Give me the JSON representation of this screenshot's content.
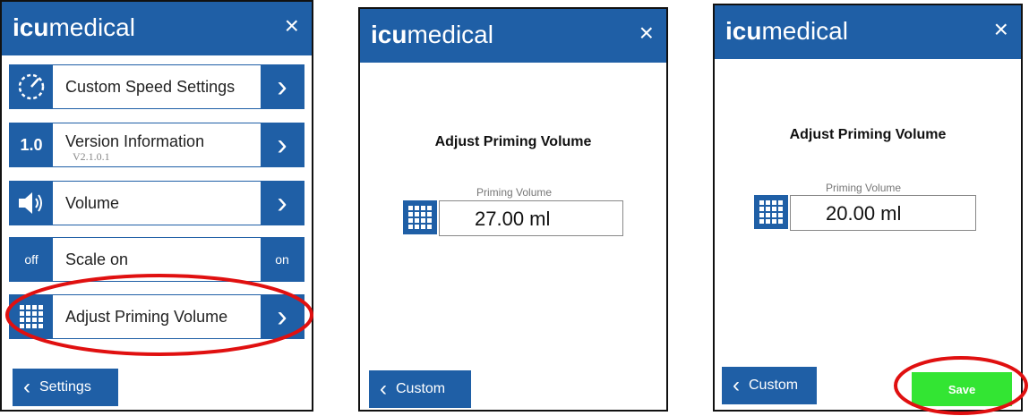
{
  "logo": {
    "bold": "icu",
    "light": "medical"
  },
  "close_glyph": "×",
  "screen1": {
    "rows": [
      {
        "icon": "speedometer-icon",
        "label": "Custom Speed Settings"
      },
      {
        "badge": "1.0",
        "label": "Version Information",
        "sub": "V2.1.0.1"
      },
      {
        "icon": "speaker-icon",
        "label": "Volume"
      },
      {
        "left": "off",
        "label": "Scale on",
        "right": "on"
      },
      {
        "icon": "keypad-icon",
        "label": "Adjust Priming Volume"
      }
    ],
    "back_label": "Settings"
  },
  "screen2": {
    "title": "Adjust Priming Volume",
    "field_label": "Priming Volume",
    "value": "27.00 ml",
    "back_label": "Custom"
  },
  "screen3": {
    "title": "Adjust Priming Volume",
    "field_label": "Priming Volume",
    "value": "20.00 ml",
    "back_label": "Custom",
    "save_label": "Save"
  },
  "colors": {
    "brand_blue": "#1f5fa6",
    "save_green": "#33e533",
    "highlight_red": "#e01010"
  }
}
